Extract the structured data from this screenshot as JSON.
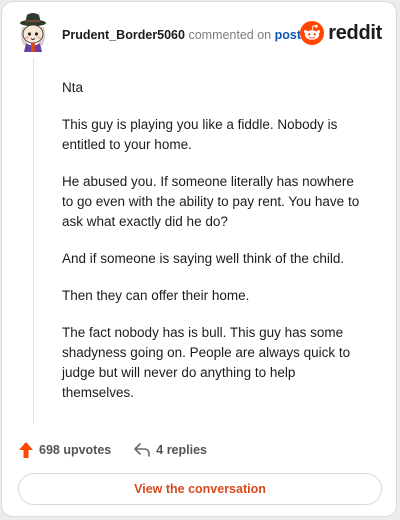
{
  "header": {
    "username": "Prudent_Border5060",
    "action_text": "commented on",
    "post_link": "post",
    "logo_text": "reddit",
    "avatar_icon": "snoo-avatar-icon",
    "logo_icon": "reddit-snoo-icon"
  },
  "comment": {
    "paragraphs": [
      "Nta",
      "This guy is playing you like a fiddle. Nobody is entitled to your home.",
      "He abused you. If someone literally has nowhere to go even with the ability to pay rent. You have to ask what exactly did he do?",
      "And if someone is saying well think of the child.",
      "Then they can offer their home.",
      "The fact nobody has is bull. This guy has some shadyness going on. People are always quick to judge but will never do anything to help themselves."
    ]
  },
  "footer": {
    "upvotes": "698 upvotes",
    "replies": "4 replies",
    "view_button": "View the conversation"
  },
  "colors": {
    "reddit_orange": "#ff4500",
    "link_blue": "#0a56b8",
    "button_text": "#d84a1b"
  }
}
